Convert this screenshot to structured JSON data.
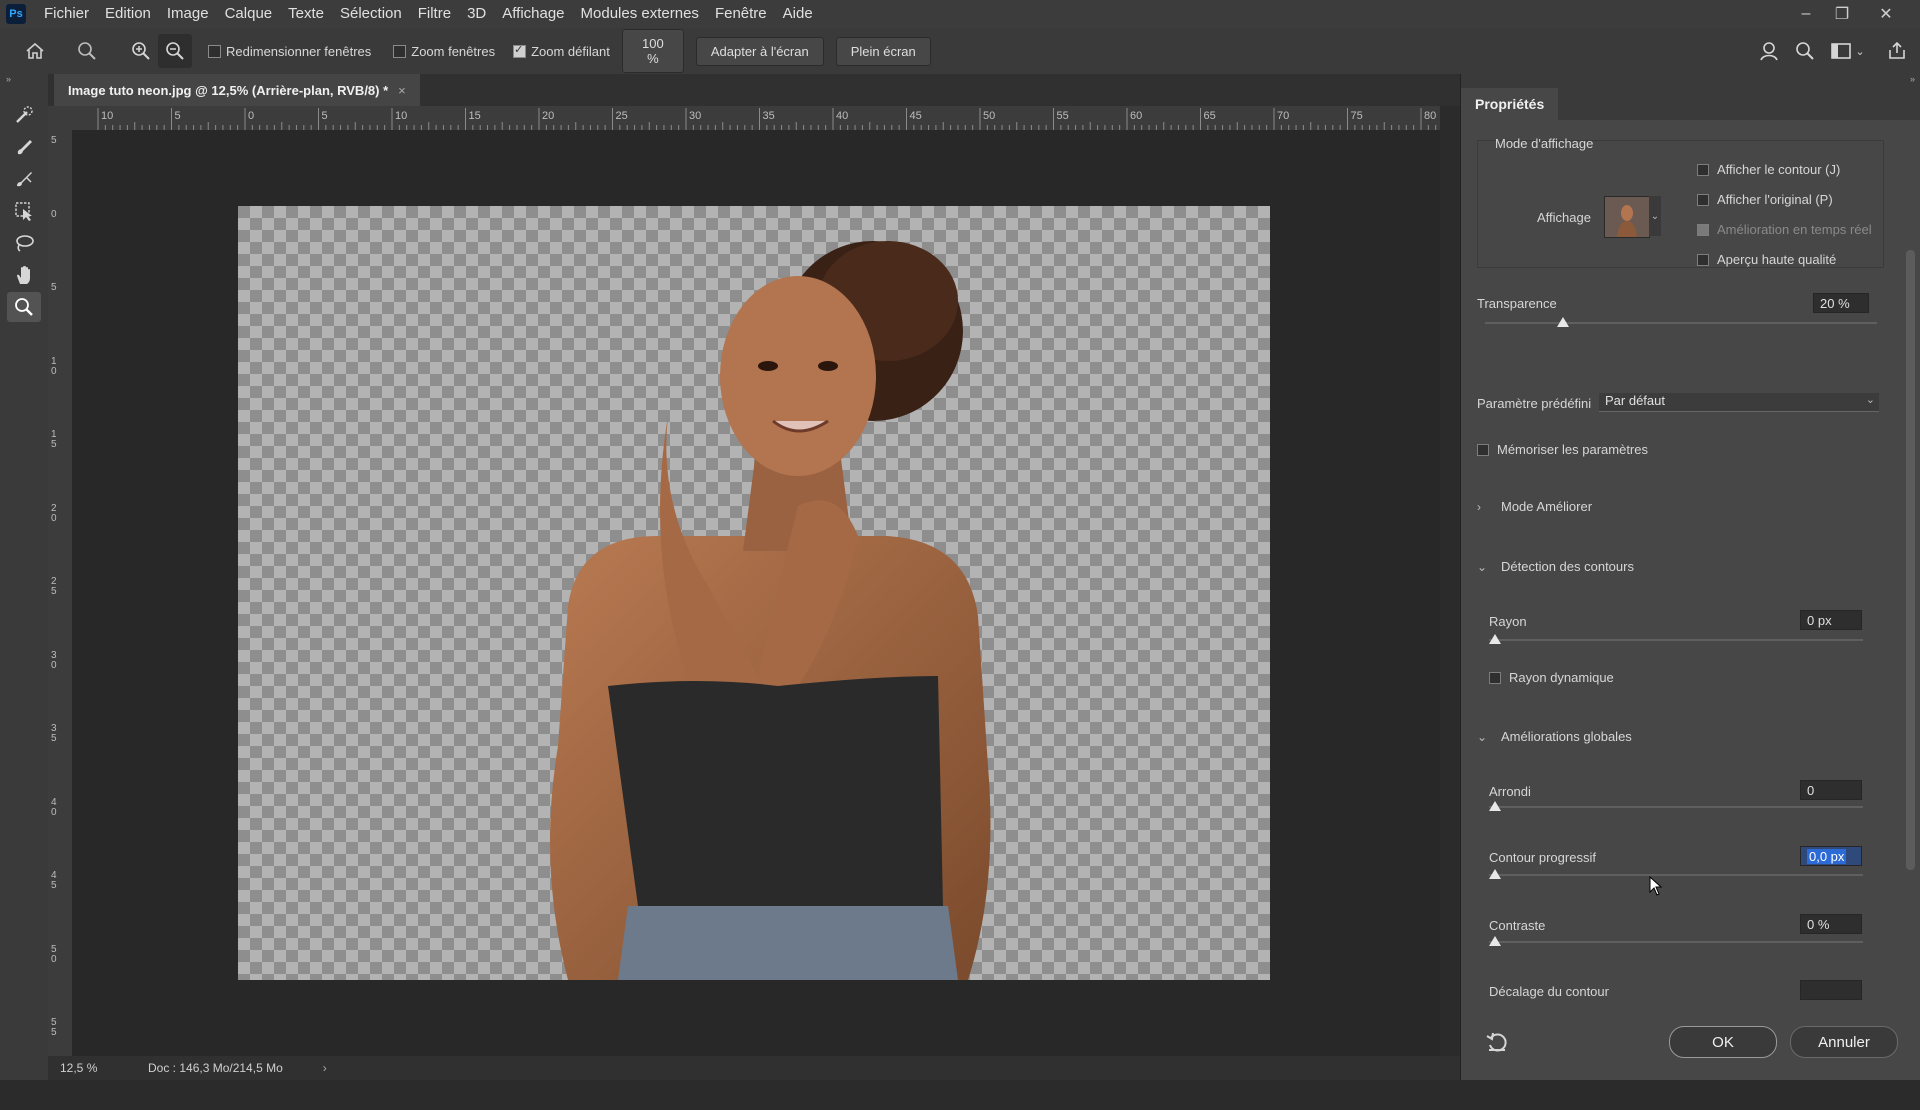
{
  "app": {
    "logo": "Ps"
  },
  "menu": [
    "Fichier",
    "Edition",
    "Image",
    "Calque",
    "Texte",
    "Sélection",
    "Filtre",
    "3D",
    "Affichage",
    "Modules externes",
    "Fenêtre",
    "Aide"
  ],
  "window_controls": {
    "minimize": "–",
    "restore": "❐",
    "close": "✕"
  },
  "options_bar": {
    "resize_windows": "Redimensionner fenêtres",
    "zoom_windows": "Zoom fenêtres",
    "scrubby_zoom": "Zoom défilant",
    "zoom_value": "100 %",
    "fit_screen": "Adapter à l'écran",
    "full_screen": "Plein écran"
  },
  "document": {
    "tab_title": "Image tuto neon.jpg @ 12,5% (Arrière-plan, RVB/8) *",
    "tab_close": "×"
  },
  "ruler": {
    "h_ticks": [
      "10",
      "5",
      "0",
      "5",
      "10",
      "15",
      "20",
      "25",
      "30",
      "35",
      "40",
      "45",
      "50",
      "55",
      "60",
      "65",
      "70",
      "75",
      "80"
    ],
    "v_ticks": [
      "5",
      "0",
      "5",
      "1 0",
      "1 5",
      "2 0",
      "2 5",
      "3 0",
      "3 5",
      "4 0",
      "4 5",
      "5 0",
      "5 5"
    ]
  },
  "status": {
    "zoom": "12,5 %",
    "doc": "Doc : 146,3 Mo/214,5 Mo",
    "arrow": "›"
  },
  "panel": {
    "tab": "Propriétés",
    "view_mode": {
      "title": "Mode d'affichage",
      "view_label": "Affichage",
      "show_edge": "Afficher le contour (J)",
      "show_original": "Afficher l'original (P)",
      "realtime": "Amélioration en temps réel",
      "hq_preview": "Aperçu haute qualité"
    },
    "transparency": {
      "label": "Transparence",
      "value": "20 %",
      "level": 0.2
    },
    "preset": {
      "label": "Paramètre prédéfini",
      "value": "Par défaut"
    },
    "remember": "Mémoriser les paramètres",
    "refine_mode": "Mode Améliorer",
    "edge_detection": {
      "title": "Détection des contours",
      "radius_label": "Rayon",
      "radius_value": "0 px",
      "smart_radius": "Rayon dynamique"
    },
    "global": {
      "title": "Améliorations globales",
      "smooth_label": "Arrondi",
      "smooth_value": "0",
      "feather_label": "Contour progressif",
      "feather_value": "0,0 px",
      "contrast_label": "Contraste",
      "contrast_value": "0 %",
      "shift_label": "Décalage du contour"
    },
    "ok": "OK",
    "cancel": "Annuler"
  }
}
